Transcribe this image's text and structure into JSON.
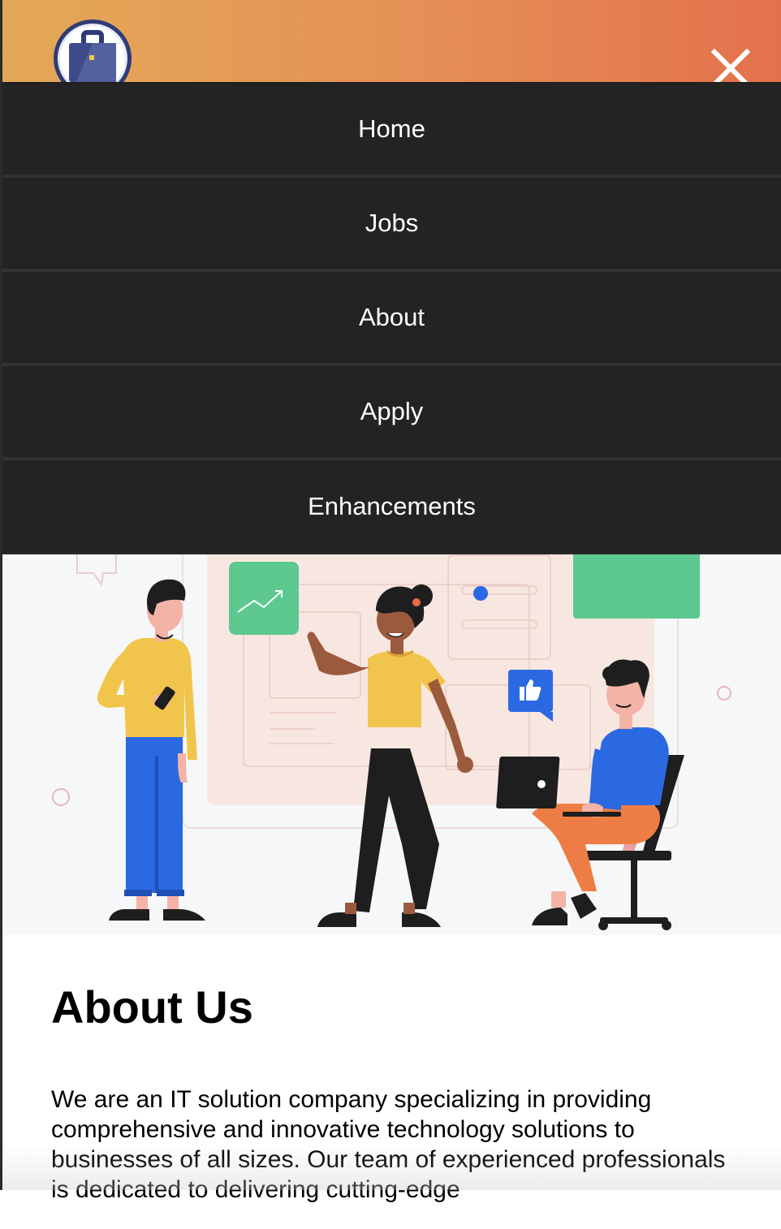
{
  "header": {
    "logo_icon": "briefcase-icon",
    "close_icon": "close-icon",
    "gradient": [
      "#e3a957",
      "#e4714d"
    ]
  },
  "nav": {
    "items": [
      {
        "label": "Home"
      },
      {
        "label": "Jobs"
      },
      {
        "label": "About"
      },
      {
        "label": "Apply"
      },
      {
        "label": "Enhancements"
      }
    ]
  },
  "about": {
    "title": "About Us",
    "text": "We are an IT solution company specializing in providing comprehensive and innovative technology solutions to businesses of all sizes. Our team of experienced professionals is dedicated to delivering cutting-edge"
  },
  "hero": {
    "illustration": "team-collaboration-illustration"
  }
}
